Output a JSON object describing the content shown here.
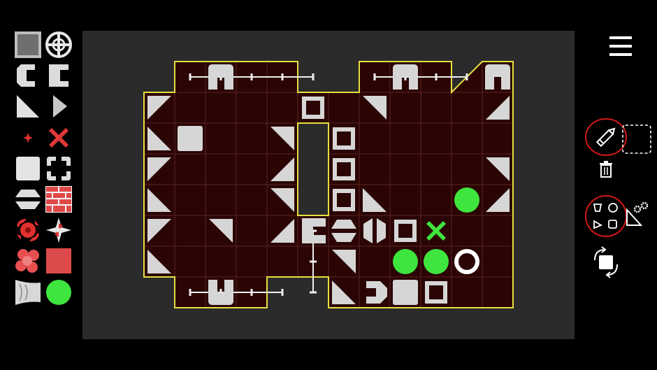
{
  "palette": {
    "items": [
      {
        "name": "metal-block-tool",
        "icon": "gray-square-block-selected",
        "selected": true
      },
      {
        "name": "target-crosshair-tool",
        "icon": "crosshair-circle"
      },
      {
        "name": "clamp-c-left-tool",
        "icon": "c-clamp-open-left"
      },
      {
        "name": "clamp-c-right-tool",
        "icon": "c-clamp-open-right"
      },
      {
        "name": "ramp-triangle-tool",
        "icon": "right-triangle"
      },
      {
        "name": "arrow-triangle-tool",
        "icon": "triangle-pointing-right"
      },
      {
        "name": "red-star-dot-tool",
        "icon": "small-red-star"
      },
      {
        "name": "red-x-tool",
        "icon": "red-x-mark"
      },
      {
        "name": "white-square-tool",
        "icon": "white-square"
      },
      {
        "name": "corner-brackets-tool",
        "icon": "four-corner-pieces"
      },
      {
        "name": "split-hexagon-tool",
        "icon": "split-hexagon"
      },
      {
        "name": "brick-wall-tool",
        "icon": "red-brick-wall"
      },
      {
        "name": "red-spinner-tool",
        "icon": "red-rotating-blade"
      },
      {
        "name": "shuriken-tool",
        "icon": "four-point-star"
      },
      {
        "name": "red-cluster-tool",
        "icon": "red-bubble-cluster"
      },
      {
        "name": "red-square-tool",
        "icon": "red-square"
      },
      {
        "name": "funnel-tool",
        "icon": "gray-funnel"
      },
      {
        "name": "green-ball-tool",
        "icon": "green-circle"
      }
    ]
  },
  "board": {
    "colors": {
      "cell": "#2b0404",
      "grid": "#5a2525",
      "border": "#e6e040",
      "piece": "#d6d6d6",
      "green": "#3ee53e",
      "canvas": "#2b2b2b"
    },
    "triangles": [
      {
        "col": 0,
        "row": 1,
        "dir": "nw"
      },
      {
        "col": 0,
        "row": 2,
        "dir": "sw"
      },
      {
        "col": 0,
        "row": 3,
        "dir": "nw"
      },
      {
        "col": 0,
        "row": 4,
        "dir": "sw"
      },
      {
        "col": 0,
        "row": 5,
        "dir": "nw"
      },
      {
        "col": 0,
        "row": 6,
        "dir": "sw"
      },
      {
        "col": 2,
        "row": 5,
        "dir": "ne"
      },
      {
        "col": 4,
        "row": 2,
        "dir": "ne"
      },
      {
        "col": 4,
        "row": 3,
        "dir": "se"
      },
      {
        "col": 4,
        "row": 4,
        "dir": "ne"
      },
      {
        "col": 4,
        "row": 5,
        "dir": "se"
      },
      {
        "col": 6,
        "row": 6,
        "dir": "ne"
      },
      {
        "col": 6,
        "row": 7,
        "dir": "sw"
      },
      {
        "col": 7,
        "row": 1,
        "dir": "ne"
      },
      {
        "col": 7,
        "row": 4,
        "dir": "sw"
      },
      {
        "col": 11,
        "row": 1,
        "dir": "se"
      },
      {
        "col": 11,
        "row": 3,
        "dir": "ne"
      },
      {
        "col": 11,
        "row": 4,
        "dir": "se"
      }
    ],
    "squares": [
      {
        "col": 1,
        "row": 2
      },
      {
        "col": 8,
        "row": 7
      }
    ],
    "corner_brackets": [
      {
        "col": 5,
        "row": 1
      },
      {
        "col": 6,
        "row": 2
      },
      {
        "col": 6,
        "row": 3
      },
      {
        "col": 6,
        "row": 4
      },
      {
        "col": 8,
        "row": 5
      },
      {
        "col": 9,
        "row": 7
      }
    ],
    "split_hexagons": [
      {
        "col": 6,
        "row": 5
      }
    ],
    "split_diamonds": [
      {
        "col": 7,
        "row": 5
      }
    ],
    "green_balls": [
      {
        "col": 10,
        "row": 4
      },
      {
        "col": 8,
        "row": 6
      },
      {
        "col": 9,
        "row": 6
      }
    ],
    "green_x": [
      {
        "col": 9,
        "row": 5
      }
    ],
    "white_rings": [
      {
        "col": 10,
        "row": 6
      }
    ],
    "clamps": [
      {
        "col": 2,
        "row": 0,
        "dir": "down"
      },
      {
        "col": 8,
        "row": 0,
        "dir": "down"
      },
      {
        "col": 11,
        "row": 0,
        "dir": "down"
      },
      {
        "col": 2,
        "row": 7,
        "dir": "up"
      },
      {
        "col": 5,
        "row": 5,
        "dir": "left"
      },
      {
        "col": 7,
        "row": 7,
        "dir": "right"
      }
    ],
    "rails": [
      {
        "c1": 1,
        "r1": 0,
        "c2": 5,
        "r2": 0
      },
      {
        "c1": 7,
        "r1": 0,
        "c2": 10,
        "r2": 0
      },
      {
        "c1": 1,
        "r1": 7,
        "c2": 4,
        "r2": 7
      },
      {
        "c1": 5,
        "r1": 5,
        "c2": 5,
        "r2": 7
      }
    ]
  },
  "toolbar": {
    "icons": [
      "hamburger-menu",
      "pencil-draw",
      "dashed-selection",
      "trash-delete",
      "shapes-mode",
      "triangle-gear-settings",
      "rotate-transform"
    ],
    "accent": "#d41818"
  }
}
